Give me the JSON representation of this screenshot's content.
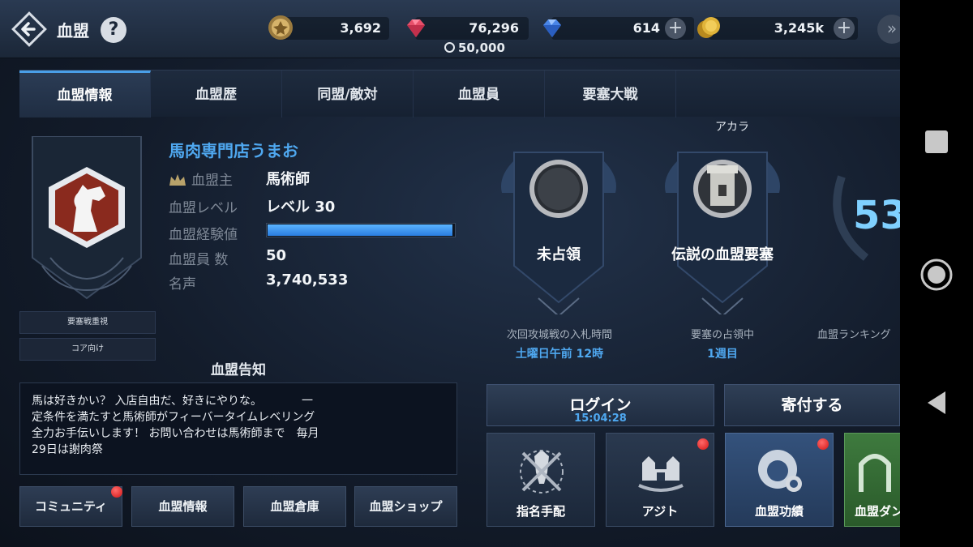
{
  "header": {
    "title": "血盟",
    "help_label": "?",
    "currencies": [
      {
        "name": "emblem-coin",
        "value": "3,692",
        "color": "#c9a15a"
      },
      {
        "name": "red-gem",
        "value": "76,296",
        "color": "#e8506a"
      },
      {
        "name": "blue-gem",
        "value": "614",
        "color": "#4a86e8"
      },
      {
        "name": "gold-coin",
        "value": "3,245k",
        "color": "#e0b43a"
      }
    ],
    "sub_timer": "50,000",
    "plus_label": "+"
  },
  "tabs": [
    {
      "label": "血盟情報",
      "active": true
    },
    {
      "label": "血盟歴"
    },
    {
      "label": "同盟/敵対"
    },
    {
      "label": "血盟員"
    },
    {
      "label": "要塞大戦"
    }
  ],
  "emblem": {
    "tags": [
      "要塞戦重視",
      "コア向け"
    ]
  },
  "clan": {
    "name": "馬肉専門店うまお",
    "rows": [
      {
        "label": "血盟主",
        "value": "馬術師"
      },
      {
        "label": "血盟レベル",
        "value": "レベル 30"
      },
      {
        "label": "血盟経験値",
        "value": ""
      },
      {
        "label": "血盟員 数",
        "value": "50"
      },
      {
        "label": "名声",
        "value": "3,740,533"
      }
    ],
    "exp_fraction": 0.99
  },
  "notice": {
    "title": "血盟告知",
    "lines": [
      "馬は好きかい？ 入店自由だ、好きにやりな。　　　　一",
      "定条件を満たすと馬術師がフィーバータイムレベリング",
      "全力お手伝いします！ お問い合わせは馬術師まで　毎月",
      "29日は謝肉祭"
    ]
  },
  "bottom_buttons": [
    {
      "label": "コミュニティ",
      "badge": true
    },
    {
      "label": "血盟情報"
    },
    {
      "label": "血盟倉庫"
    },
    {
      "label": "血盟ショップ"
    }
  ],
  "status": {
    "region": "アカラ",
    "banners": [
      {
        "label": "未占領",
        "caption": "次回攻城戦の入札時間",
        "sub": "土曜日午前 12時"
      },
      {
        "label": "伝説の血盟要塞",
        "caption": "要塞の占領中",
        "sub": "1週目"
      },
      {
        "label": "53",
        "caption": "血盟ランキング",
        "sub": ""
      }
    ]
  },
  "actions": {
    "login_label": "ログイン",
    "login_time": "15:04:28",
    "donate_label": "寄付する"
  },
  "tiles": [
    {
      "label": "指名手配",
      "badge": false
    },
    {
      "label": "アジト",
      "badge": true
    },
    {
      "label": "血盟功績",
      "badge": true
    },
    {
      "label": "血盟ダン",
      "badge": false
    }
  ]
}
